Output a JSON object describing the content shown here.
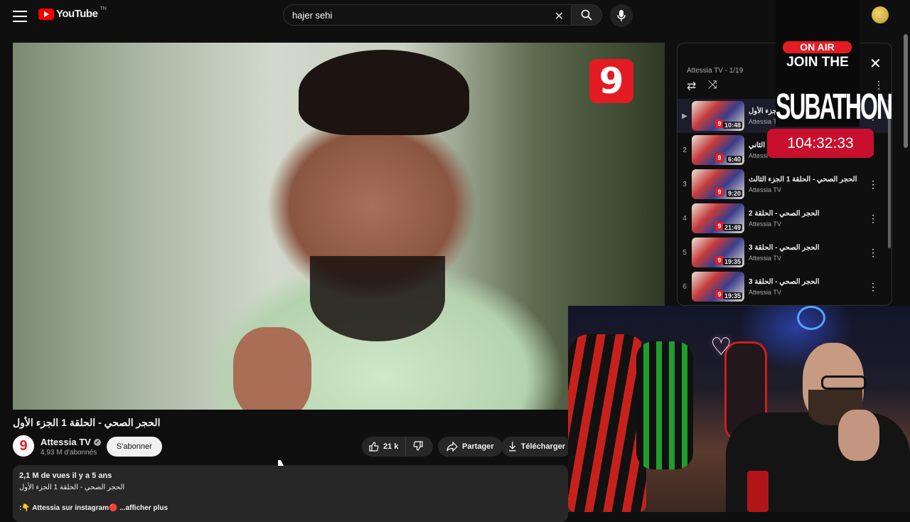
{
  "header": {
    "logo_text": "YouTube",
    "logo_sup": "TN",
    "search_value": "hajer sehi",
    "search_clear": "✕"
  },
  "video": {
    "channel_logo": "9",
    "title": "الحجر الصحي - الحلقة 1 الجزء الأول"
  },
  "channel": {
    "avatar_letter": "9",
    "name": "Attessia TV",
    "verified_mark": "✓",
    "subscribers": "4,93 M d'abonnés",
    "subscribe_label": "S'abonner"
  },
  "actions": {
    "likes": "21 k",
    "share_label": "Partager",
    "download_label": "Télécharger"
  },
  "description": {
    "meta": "2,1 M de vues  il y a 5 ans",
    "line1": "الحجر الصحي - الحلقة 1 الجزء الأول",
    "line2": ":👇 Attessia sur instagram🔴",
    "more_label": "...afficher plus"
  },
  "playlist": {
    "subtitle": "Attessia TV - 1/19",
    "items": [
      {
        "index": "▶",
        "title": "جزء الأول",
        "channel": "Attessia T",
        "duration": "10:48"
      },
      {
        "index": "2",
        "title": "ء الثاني",
        "channel": "Attessi",
        "duration": "6:40"
      },
      {
        "index": "3",
        "title": "الحجر الصحي - الحلقة 1 الجزء الثالث",
        "channel": "Attessia TV",
        "duration": "9:20"
      },
      {
        "index": "4",
        "title": "الحجر الصحي - الحلقة 2",
        "channel": "Attessia TV",
        "duration": "21:49"
      },
      {
        "index": "5",
        "title": "الحجر الصحي - الحلقة 3",
        "channel": "Attessia TV",
        "duration": "19:35"
      },
      {
        "index": "6",
        "title": "الحجر الصحي - الحلقة 3",
        "channel": "Attessia TV",
        "duration": "19:35"
      }
    ]
  },
  "overlay": {
    "on_air": "ON AIR",
    "join_the": "JOIN THE",
    "subathon": "SUBATHON",
    "timer": "104:32:33"
  },
  "colors": {
    "brand_red": "#ff0000",
    "accent_red": "#e31b23",
    "background": "#0f0f0f"
  }
}
